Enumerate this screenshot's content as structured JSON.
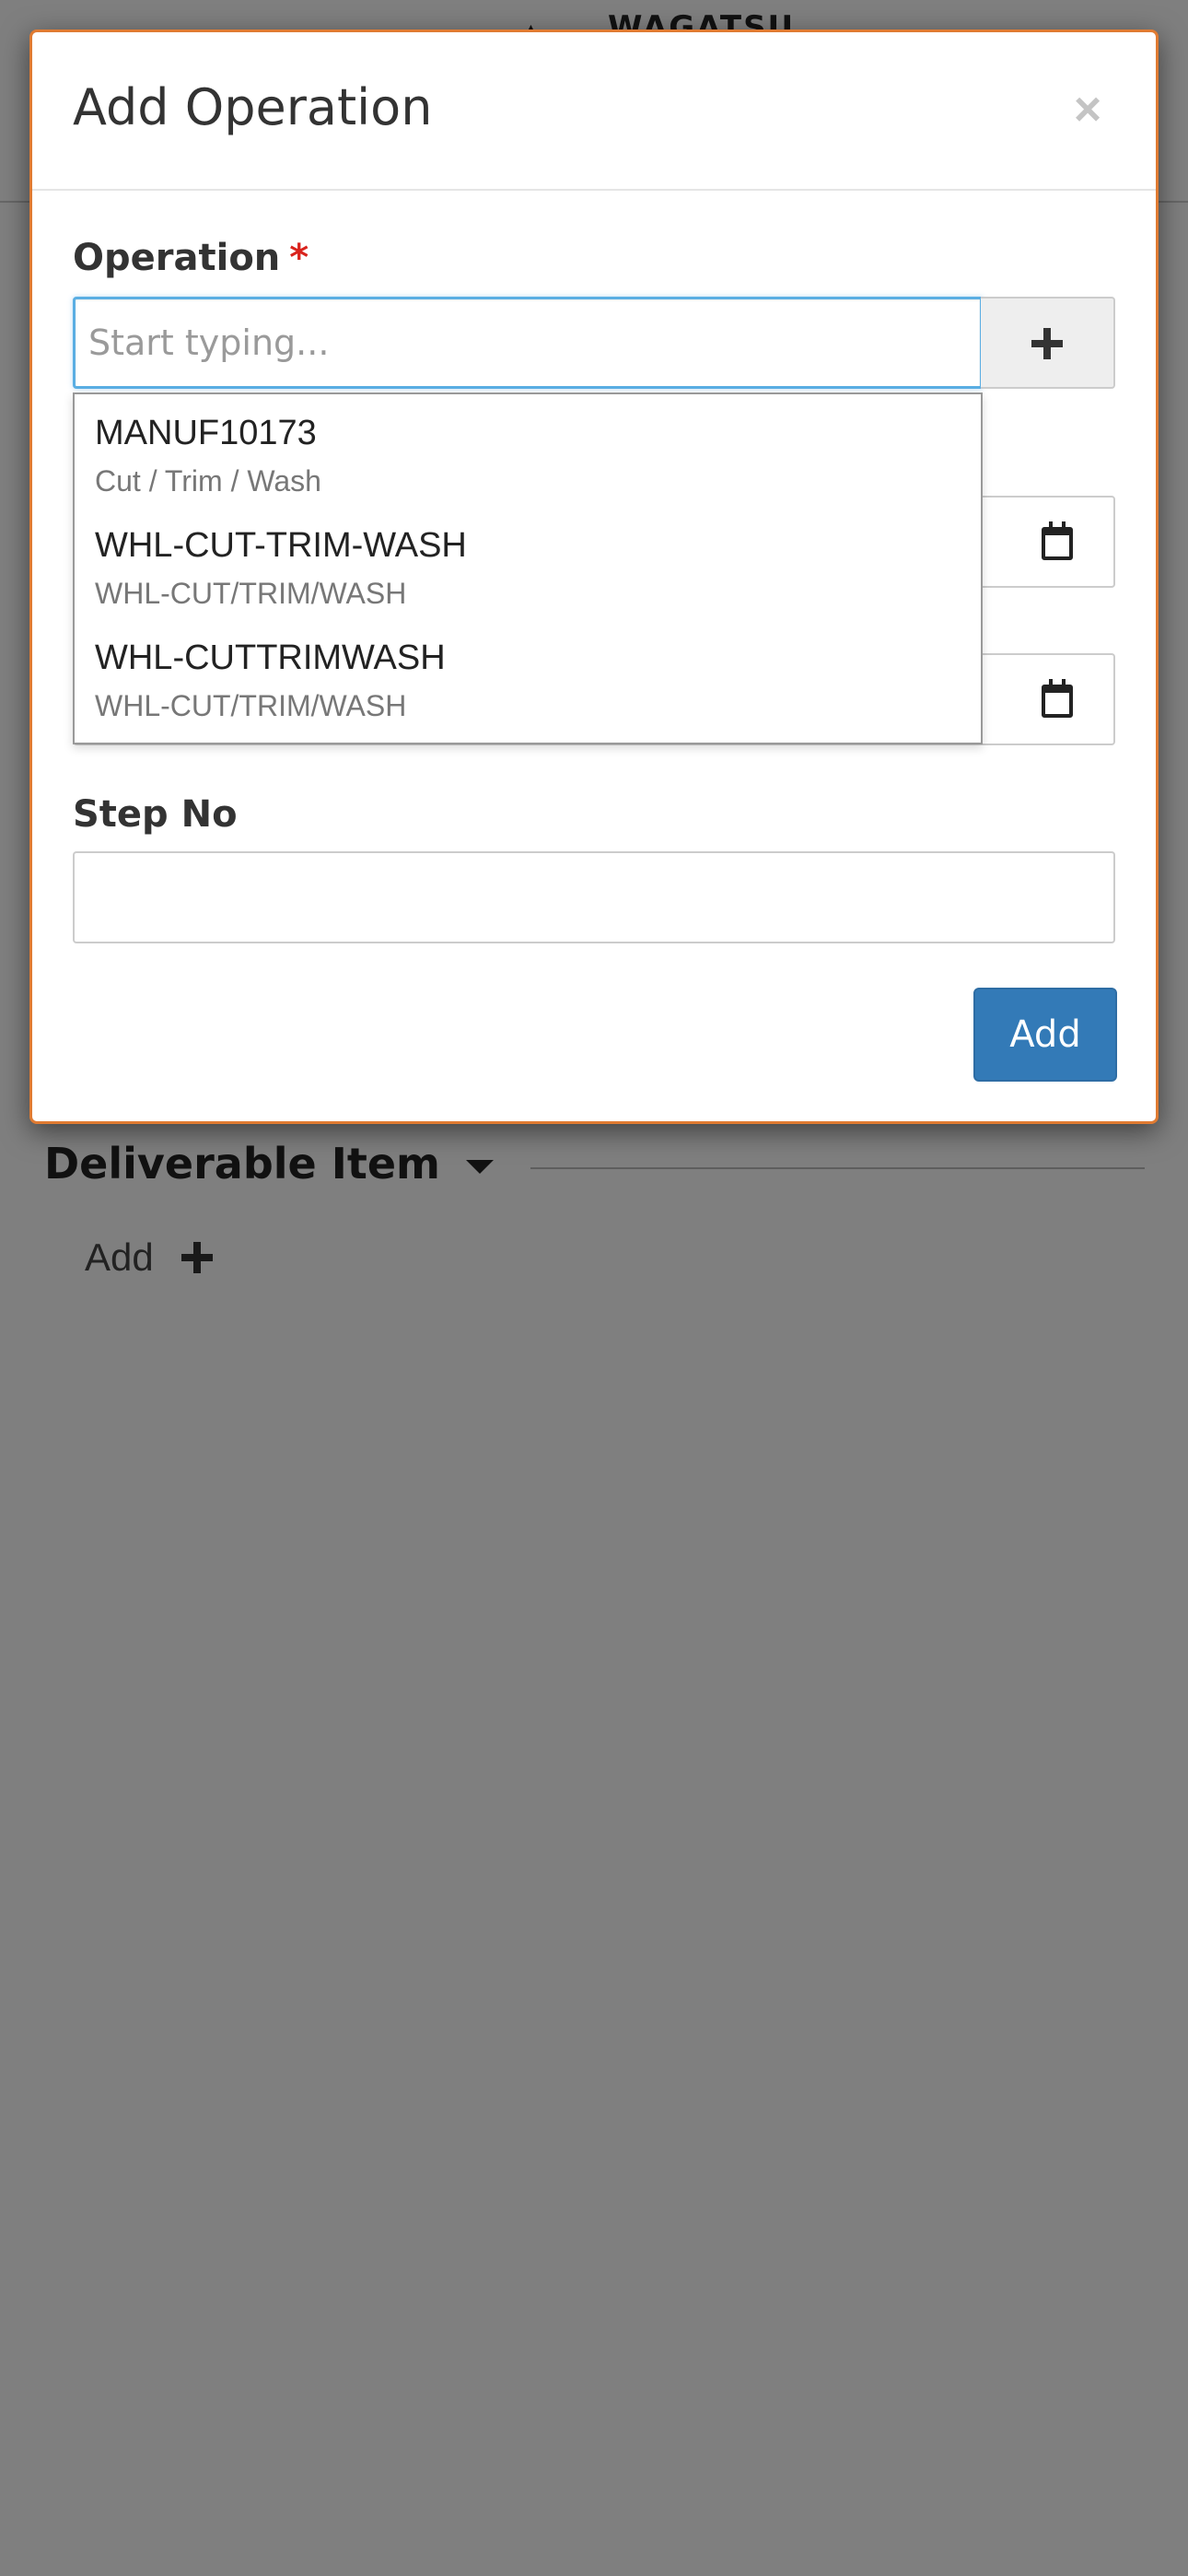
{
  "background": {
    "header_title": "WAGATSU",
    "section_title": "Deliverable Item",
    "add_label": "Add"
  },
  "modal": {
    "title": "Add Operation",
    "close_symbol": "×",
    "operation": {
      "label": "Operation",
      "required_mark": "*",
      "placeholder": "Start typing...",
      "value": ""
    },
    "step_no": {
      "label": "Step No",
      "value": ""
    },
    "submit_label": "Add",
    "accent_color": "#337ab7",
    "border_color": "#e07b32"
  },
  "autocomplete": {
    "items": [
      {
        "code": "MANUF10173",
        "description": "Cut / Trim / Wash"
      },
      {
        "code": "WHL-CUT-TRIM-WASH",
        "description": "WHL-CUT/TRIM/WASH"
      },
      {
        "code": "WHL-CUTTRIMWASH",
        "description": "WHL-CUT/TRIM/WASH"
      }
    ]
  },
  "icons": [
    "close-icon",
    "plus-icon",
    "calendar-icon",
    "chevron-down-icon"
  ]
}
